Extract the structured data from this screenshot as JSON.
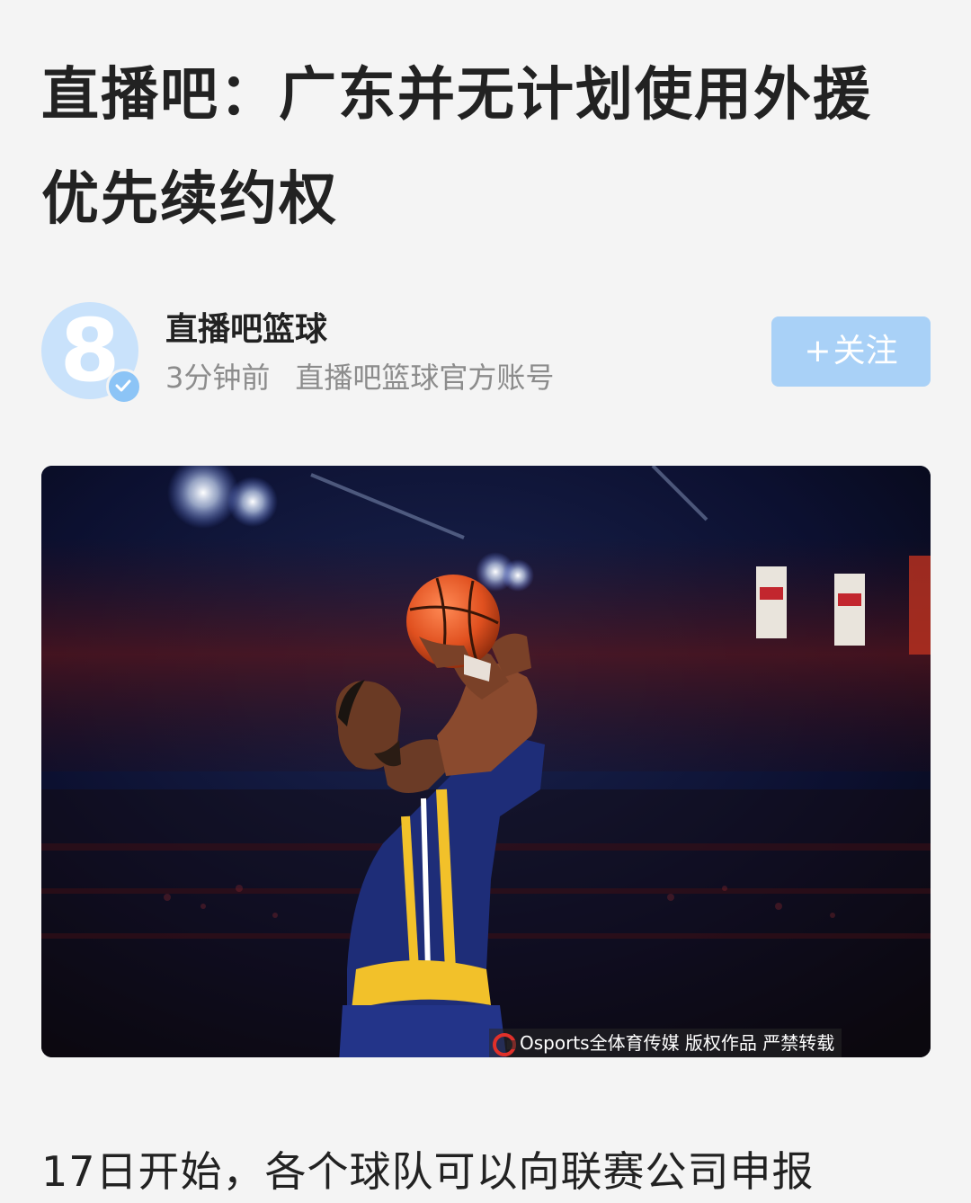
{
  "article": {
    "title": "直播吧：广东并无计划使用外援优先续约权",
    "author": {
      "name": "直播吧篮球",
      "avatar_glyph": "8",
      "time": "3分钟前",
      "description": "直播吧篮球官方账号",
      "verified_icon": "check-icon"
    },
    "follow_button": {
      "plus": "+",
      "label": "关注"
    },
    "image": {
      "watermark": "Osports全体育传媒  版权作品 严禁转载"
    },
    "body_first_line": "17日开始，各个球队可以向联赛公司申报"
  },
  "colors": {
    "background": "#f4f4f4",
    "title_text": "#222222",
    "meta_text": "#8c8c8c",
    "avatar_bg": "#c9e2fb",
    "follow_button_bg": "#a9d1f7"
  }
}
